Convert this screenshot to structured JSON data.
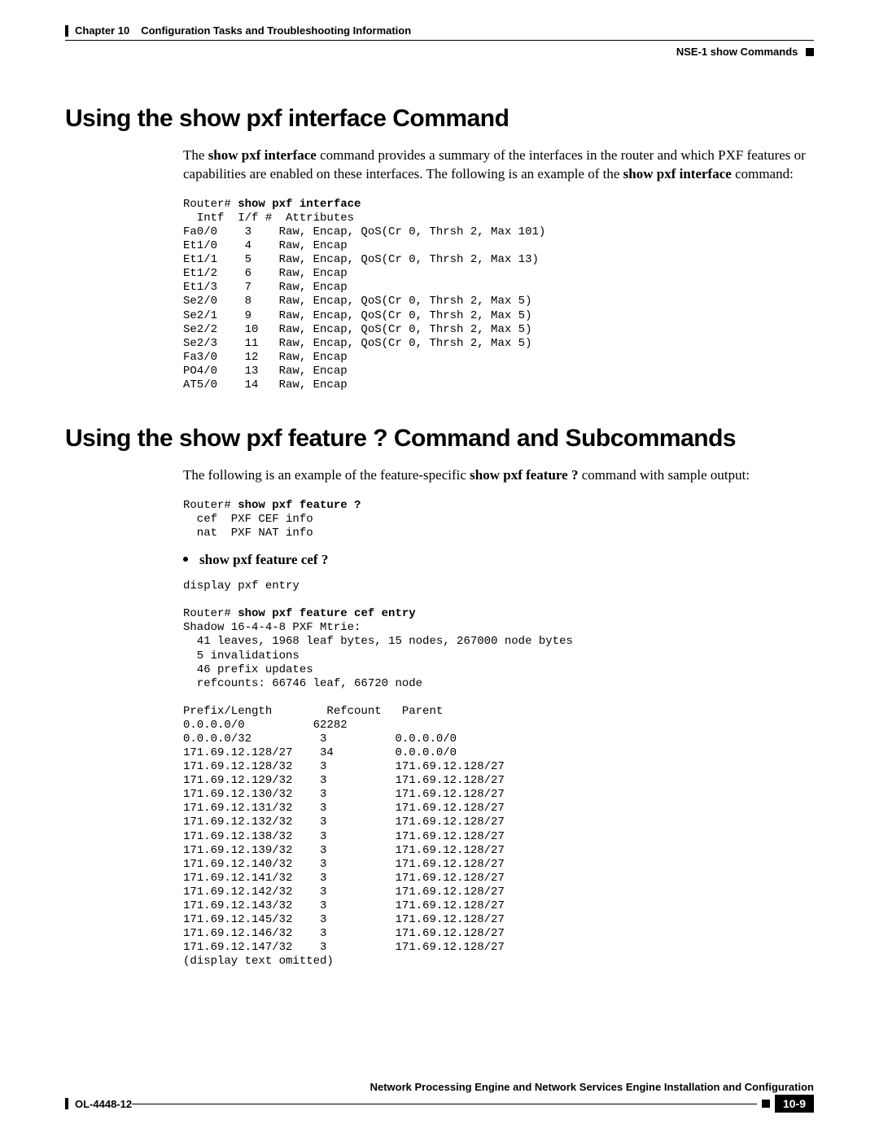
{
  "header": {
    "chapter": "Chapter 10",
    "title": "Configuration Tasks and Troubleshooting Information",
    "breadcrumb": "NSE-1 show Commands"
  },
  "section1": {
    "heading": "Using the show pxf interface Command",
    "para_pre": "The ",
    "para_cmd1": "show pxf interface",
    "para_mid": " command provides a summary of the interfaces in the router and which PXF features or capabilities are enabled on these interfaces. The following is an example of the ",
    "para_cmd2": "show pxf interface",
    "para_post": " command:",
    "code_prompt": "Router# ",
    "code_cmd": "show pxf interface",
    "code_body": "  Intf  I/f #  Attributes\nFa0/0    3    Raw, Encap, QoS(Cr 0, Thrsh 2, Max 101)\nEt1/0    4    Raw, Encap\nEt1/1    5    Raw, Encap, QoS(Cr 0, Thrsh 2, Max 13)\nEt1/2    6    Raw, Encap\nEt1/3    7    Raw, Encap\nSe2/0    8    Raw, Encap, QoS(Cr 0, Thrsh 2, Max 5)\nSe2/1    9    Raw, Encap, QoS(Cr 0, Thrsh 2, Max 5)\nSe2/2    10   Raw, Encap, QoS(Cr 0, Thrsh 2, Max 5)\nSe2/3    11   Raw, Encap, QoS(Cr 0, Thrsh 2, Max 5)\nFa3/0    12   Raw, Encap\nPO4/0    13   Raw, Encap\nAT5/0    14   Raw, Encap"
  },
  "section2": {
    "heading": "Using the show pxf feature ? Command and Subcommands",
    "para_pre": "The following is an example of the feature-specific ",
    "para_cmd": "show pxf feature ?",
    "para_post": " command with sample output:",
    "code1_prompt": "Router# ",
    "code1_cmd": "show pxf feature ?",
    "code1_body": "  cef  PXF CEF info\n  nat  PXF NAT info",
    "bullet": "show pxf feature cef ?",
    "code2_pre": "display pxf entry\n\n",
    "code2_prompt": "Router# ",
    "code2_cmd": "show pxf feature cef entry",
    "code2_body": "\nShadow 16-4-4-8 PXF Mtrie:\n  41 leaves, 1968 leaf bytes, 15 nodes, 267000 node bytes\n  5 invalidations\n  46 prefix updates\n  refcounts: 66746 leaf, 66720 node\n\nPrefix/Length        Refcount   Parent\n0.0.0.0/0          62282\n0.0.0.0/32          3          0.0.0.0/0\n171.69.12.128/27    34         0.0.0.0/0\n171.69.12.128/32    3          171.69.12.128/27\n171.69.12.129/32    3          171.69.12.128/27\n171.69.12.130/32    3          171.69.12.128/27\n171.69.12.131/32    3          171.69.12.128/27\n171.69.12.132/32    3          171.69.12.128/27\n171.69.12.138/32    3          171.69.12.128/27\n171.69.12.139/32    3          171.69.12.128/27\n171.69.12.140/32    3          171.69.12.128/27\n171.69.12.141/32    3          171.69.12.128/27\n171.69.12.142/32    3          171.69.12.128/27\n171.69.12.143/32    3          171.69.12.128/27\n171.69.12.145/32    3          171.69.12.128/27\n171.69.12.146/32    3          171.69.12.128/27\n171.69.12.147/32    3          171.69.12.128/27\n(display text omitted)"
  },
  "footer": {
    "book_title": "Network Processing Engine and Network Services Engine Installation and Configuration",
    "doc_id": "OL-4448-12",
    "page_number": "10-9"
  }
}
